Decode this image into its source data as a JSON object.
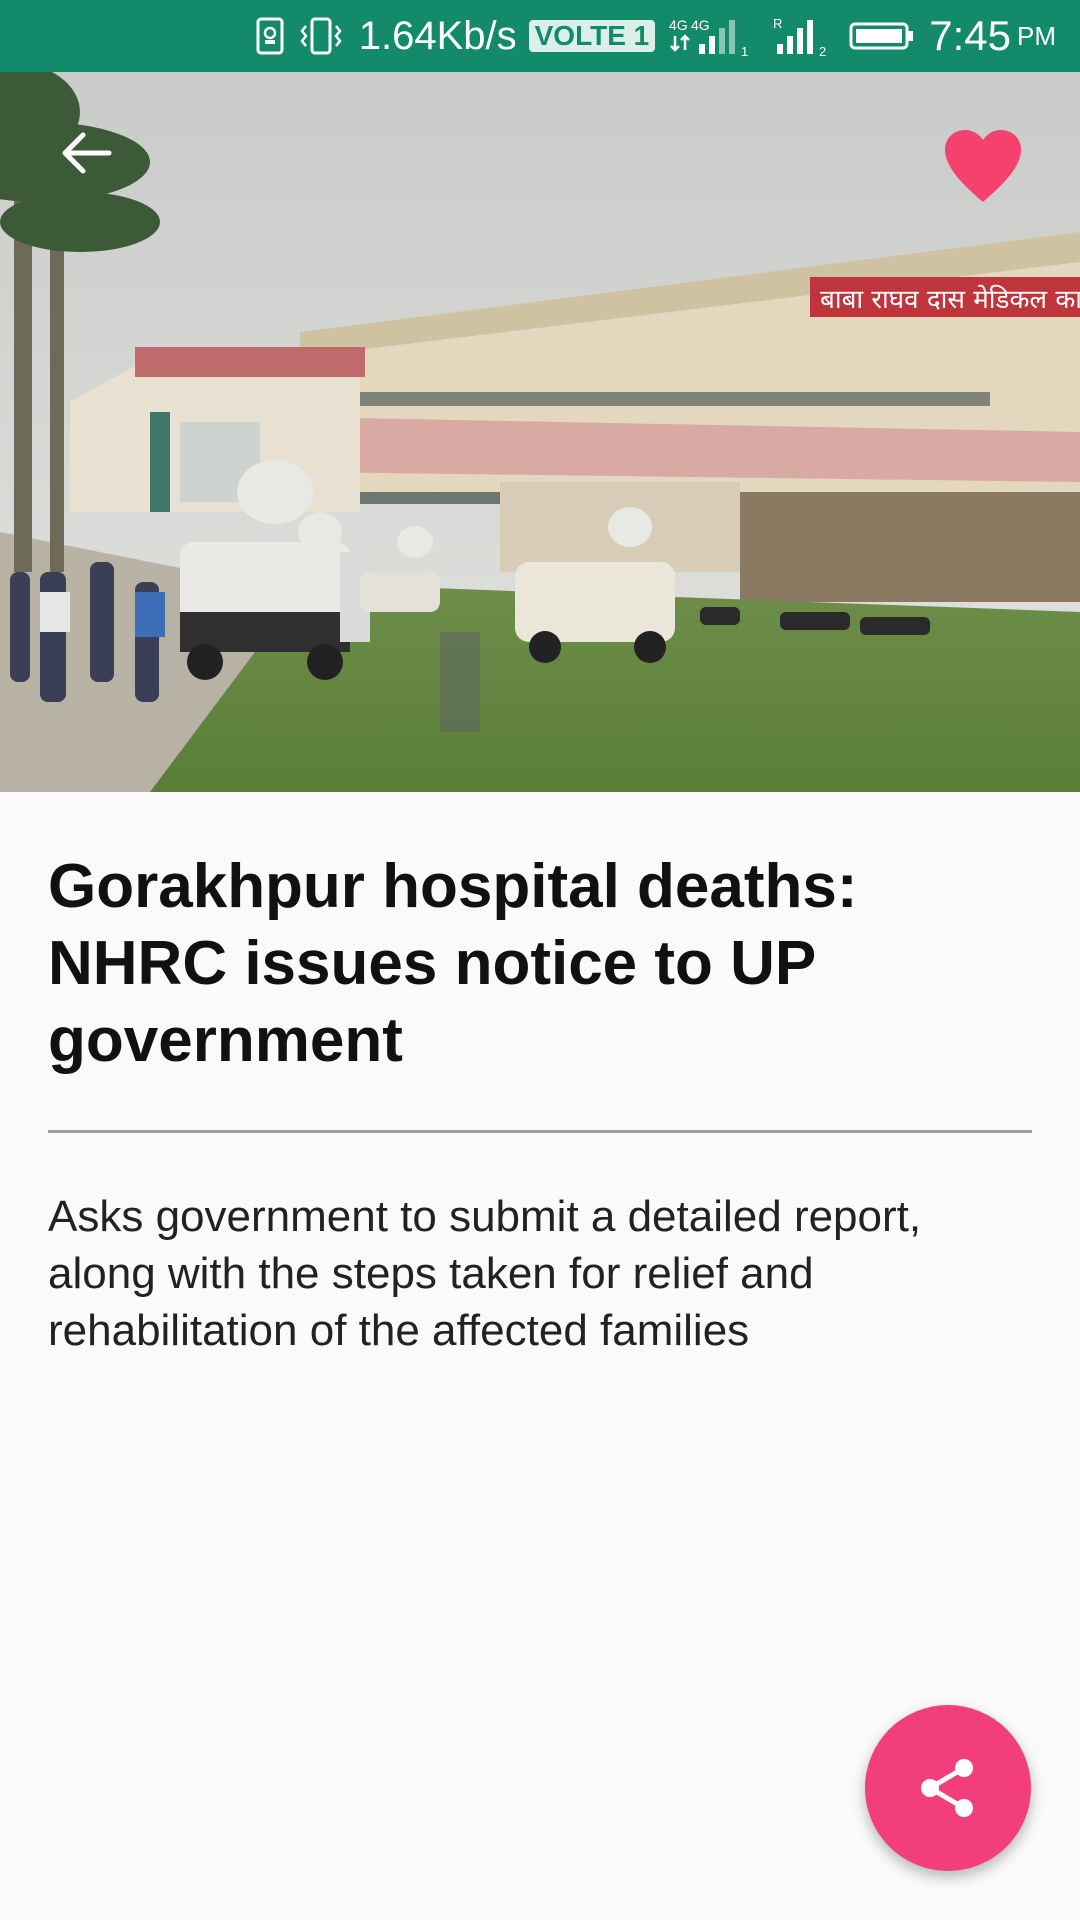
{
  "status_bar": {
    "speed": "1.64Kb/s",
    "volte": "VOLTE 1",
    "network_1": "4G",
    "network_2": "4G",
    "roaming": "R",
    "time": "7:45",
    "ampm": "PM"
  },
  "hero": {
    "sign_text": "बाबा राघव दास मेडिकल का",
    "back_icon": "arrow-back-icon",
    "favorite_icon": "heart-icon",
    "favorite_color": "#f4416e"
  },
  "article": {
    "title": "Gorakhpur hospital deaths: NHRC issues notice to UP government",
    "summary": "Asks government to submit a detailed report, along with the steps taken for relief and rehabilitation of the affected families"
  },
  "fab": {
    "icon": "share-icon",
    "color": "#f23f7b"
  },
  "colors": {
    "status_bar": "#138a6a",
    "background": "#fafafa"
  }
}
